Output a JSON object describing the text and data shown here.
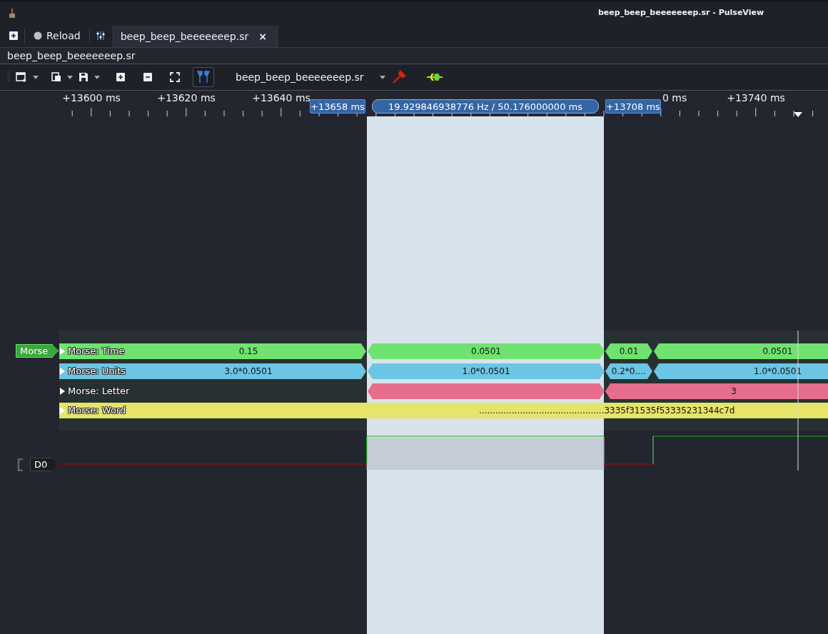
{
  "window": {
    "title": "beep_beep_beeeeeeep.sr - PulseView"
  },
  "session_bar": {
    "reload": "Reload",
    "tabs": [
      {
        "label": "beep_beep_beeeeeeep.sr",
        "close": "×",
        "selected": true
      }
    ]
  },
  "view_title": "beep_beep_beeeeeeep.sr",
  "toolbar": {
    "cursors_on": true,
    "device": "beep_beep_beeeeeeep.sr"
  },
  "ruler": {
    "labels": [
      "+13600 ms",
      "+13620 ms",
      "+13640 ms",
      "0 ms",
      "+13740 ms"
    ]
  },
  "cursors": {
    "start": "+13658 ms",
    "measurement": "19.929846938776 Hz / 50.176000000 ms",
    "end": "+13708 ms"
  },
  "decoder": {
    "name": "Morse",
    "rows": [
      {
        "name": "Morse: Time",
        "color": "#6fe26f",
        "annotations": [
          "0.15",
          "0.0501",
          "0.01",
          "0.0501"
        ]
      },
      {
        "name": "Morse: Units",
        "color": "#6cc5e5",
        "annotations": [
          "3.0*0.0501",
          "1.0*0.0501",
          "0.2*0.…",
          "1.0*0.0501"
        ]
      },
      {
        "name": "Morse: Letter",
        "color": "#e66d8c",
        "annotations": [
          "3"
        ]
      },
      {
        "name": "Morse: Word",
        "color": "#e6e46a",
        "annotations": [
          "..............................................3335f31535f53335231344c7d"
        ]
      }
    ]
  },
  "channels": [
    {
      "name": "D0"
    }
  ]
}
